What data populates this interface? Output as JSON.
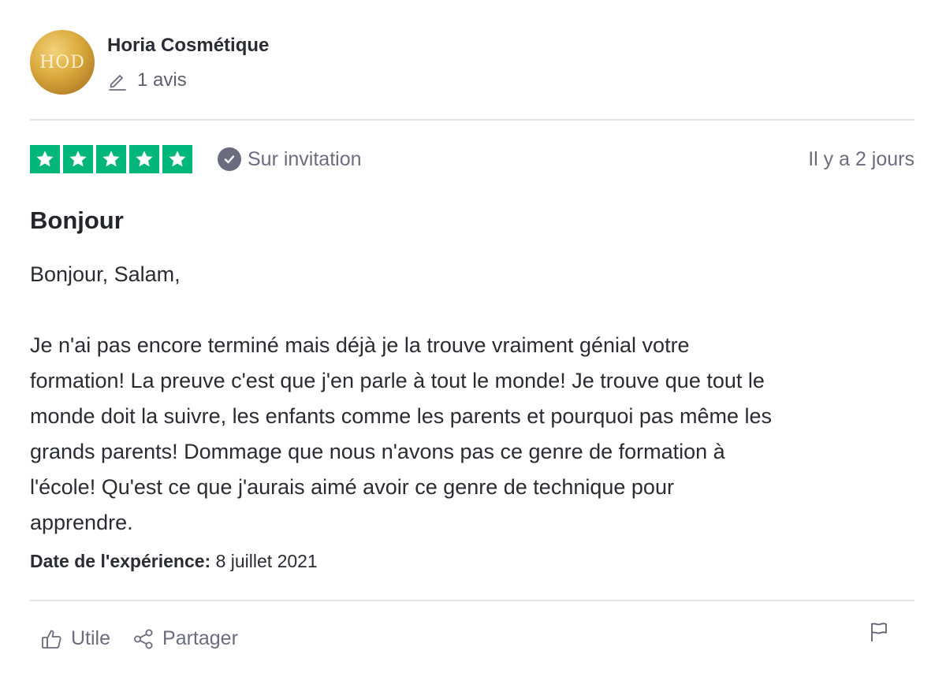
{
  "reviewer": {
    "avatar_text": "HOD",
    "name": "Horia Cosmétique",
    "review_count": "1 avis"
  },
  "review": {
    "rating": 5,
    "star_color": "#00b67a",
    "badge_label": "Sur invitation",
    "posted": "Il y a 2 jours",
    "title": "Bonjour",
    "greeting": "Bonjour, Salam,",
    "body_lines": [
      "Je n'ai pas encore terminé mais déjà je la trouve vraiment génial votre",
      "formation! La preuve c'est que j'en parle à tout le monde! Je trouve que tout le",
      "monde doit la suivre, les enfants comme les parents et pourquoi pas même les",
      "grands parents! Dommage que nous n'avons pas ce genre de formation à",
      "l'école! Qu'est ce que j'aurais aimé avoir ce genre de technique pour",
      "apprendre."
    ],
    "experience_label": "Date de l'expérience:",
    "experience_date": "8 juillet 2021"
  },
  "actions": {
    "useful_label": "Utile",
    "share_label": "Partager"
  }
}
